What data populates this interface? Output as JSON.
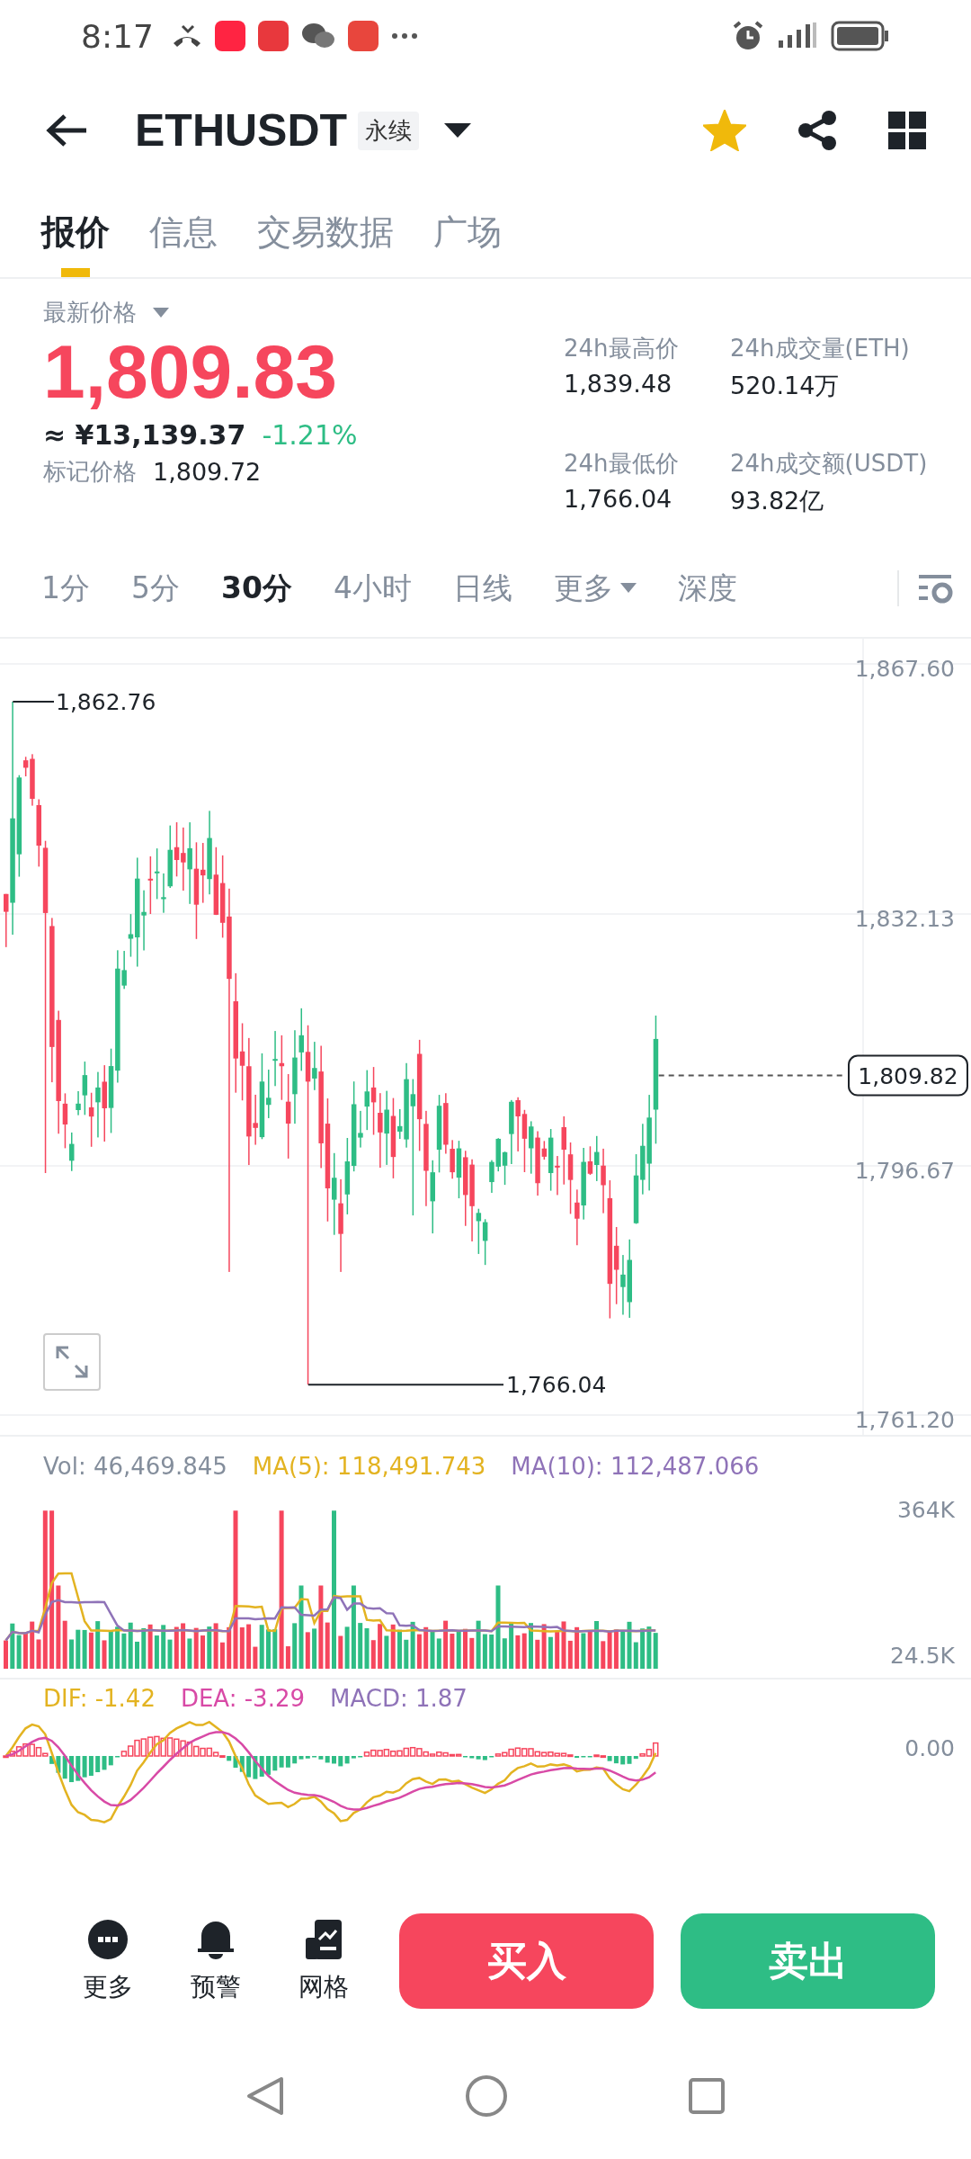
{
  "status_bar": {
    "time": "8:17"
  },
  "header": {
    "symbol": "ETHUSDT",
    "contract_tag": "永续",
    "favorite": true
  },
  "tabs": [
    {
      "label": "报价",
      "selected": true
    },
    {
      "label": "信息",
      "selected": false
    },
    {
      "label": "交易数据",
      "selected": false
    },
    {
      "label": "广场",
      "selected": false
    }
  ],
  "price": {
    "label": "最新价格",
    "last": "1,809.83",
    "cny": "≈ ¥13,139.37",
    "change": "-1.21%",
    "mark_label": "标记价格",
    "mark": "1,809.72"
  },
  "stats": [
    {
      "label": "24h最高价",
      "value": "1,839.48"
    },
    {
      "label": "24h成交量(ETH)",
      "value": "520.14万"
    },
    {
      "label": "24h最低价",
      "value": "1,766.04"
    },
    {
      "label": "24h成交额(USDT)",
      "value": "93.82亿"
    }
  ],
  "intervals": [
    {
      "label": "1分",
      "selected": false
    },
    {
      "label": "5分",
      "selected": false
    },
    {
      "label": "30分",
      "selected": true
    },
    {
      "label": "4小时",
      "selected": false
    },
    {
      "label": "日线",
      "selected": false
    },
    {
      "label": "更多",
      "selected": false,
      "kind": "menu"
    },
    {
      "label": "深度",
      "selected": false
    }
  ],
  "price_chart": {
    "axis": [
      "1,867.60",
      "1,832.13",
      "1,796.67",
      "1,761.20"
    ],
    "high_marker": "1,862.76",
    "low_marker": "1,766.04",
    "last_price": "1,809.82"
  },
  "volume": {
    "vol": "Vol: 46,469.845",
    "ma5": "MA(5): 118,491.743",
    "ma10": "MA(10): 112,487.066",
    "axis": [
      "364K",
      "24.5K"
    ]
  },
  "macd": {
    "dif": "DIF: -1.42",
    "dea": "DEA: -3.29",
    "macd": "MACD: 1.87",
    "axis": [
      "0.00"
    ]
  },
  "toolbar": [
    {
      "label": "更多",
      "kind": "more"
    },
    {
      "label": "预警",
      "kind": "alert"
    },
    {
      "label": "网格",
      "kind": "grid"
    }
  ],
  "actions": [
    {
      "label": "买入",
      "kind": "buy"
    },
    {
      "label": "卖出",
      "kind": "sell"
    }
  ]
}
